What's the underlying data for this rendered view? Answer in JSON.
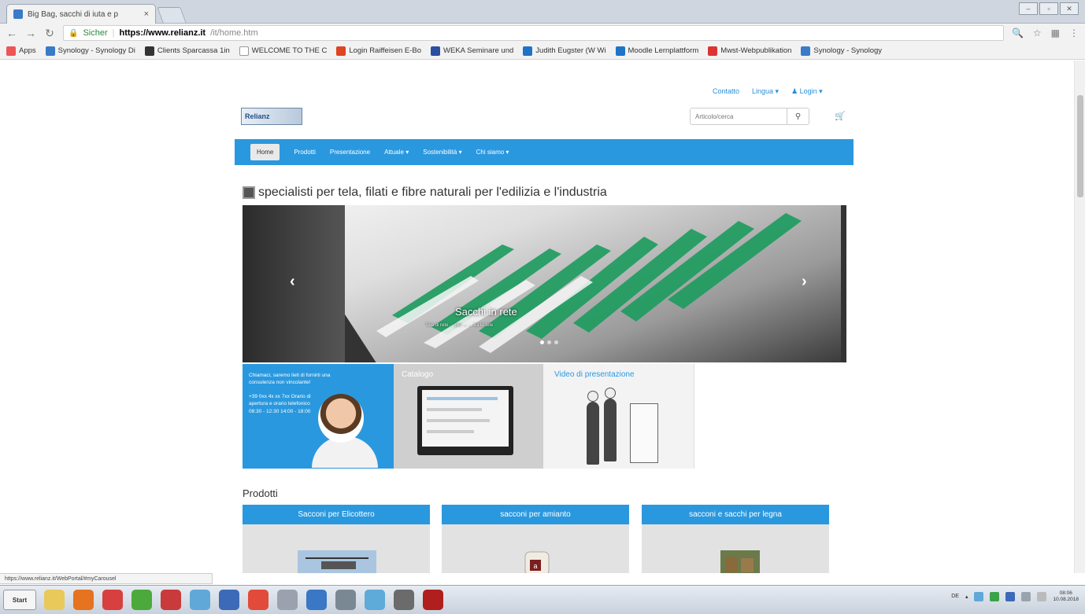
{
  "browser": {
    "tab_title": "Big Bag, sacchi di iuta e p",
    "tab_close": "×",
    "url_secure_label": "Sicher",
    "url_host": "https://www.relianz.it",
    "url_path": "/it/home.htm",
    "window_controls": [
      "–",
      "▫",
      "✕"
    ]
  },
  "bookmarks": [
    {
      "label": "Apps",
      "color": "#e55"
    },
    {
      "label": "Synology - Synology Di",
      "color": "#3a7bc8"
    },
    {
      "label": "Clients Sparcassa 1in",
      "color": "#333"
    },
    {
      "label": "WELCOME TO THE C",
      "color": "#999"
    },
    {
      "label": "Login Raiffeisen E-Bo",
      "color": "#d42"
    },
    {
      "label": "WEKA Seminare und",
      "color": "#2b4ea0"
    },
    {
      "label": "Judith Eugster (W Wi",
      "color": "#1e74c6"
    },
    {
      "label": "Moodle Lernplattform",
      "color": "#1e74c6"
    },
    {
      "label": "Mwst-Webpublikation",
      "color": "#d33"
    },
    {
      "label": "Synology - Synology",
      "color": "#3a7bc8"
    }
  ],
  "site": {
    "top_links": [
      "Contatto",
      "Lingua ▾",
      "♟ Login ▾"
    ],
    "logo_text": "Relianz",
    "search_placeholder": "Articolo/cerca",
    "nav": [
      "Home",
      "Prodotti",
      "Presentazione",
      "Attuale ▾",
      "Sostenibilità ▾",
      "Chi siamo ▾"
    ],
    "headline": "specialisti per tela, filati e fibre naturali per l'edilizia e l'industria",
    "hero": {
      "prev": "‹",
      "next": "›",
      "caption": "Sacchi in rete",
      "subcaption": "Tela di rete ... per ... ... tra le tele"
    },
    "contact_tile": {
      "line1": "Chiamaci, saremo lieti di fornirti una consulenza non vincolante!",
      "line2": "+39 0xx 4x xx 7xx Orario di apertura e orario telefonico 08:30 - 12:30 14:00 - 18:00"
    },
    "catalog_tile": "Catalogo",
    "video_tile": "Video di presentazione",
    "products_title": "Prodotti",
    "products": [
      "Sacconi per Elicottero",
      "sacconi per amianto",
      "sacconi e sacchi per legna"
    ]
  },
  "statusbar": "https://www.relianz.it/WebPortal/#myCarousel",
  "taskbar": {
    "start_label": "Start",
    "tray_lang": "DE",
    "time": "08:06",
    "date": "10.08.2018"
  }
}
